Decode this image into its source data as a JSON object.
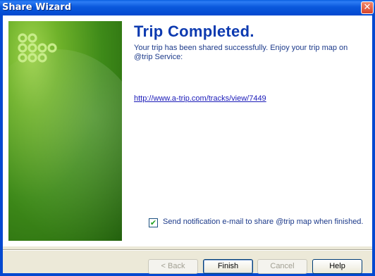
{
  "window": {
    "title": "Share Wizard",
    "close_glyph": "✕"
  },
  "content": {
    "heading": "Trip Completed.",
    "message": "Your trip has been shared successfully. Enjoy your trip map on @trip Service:",
    "link": "http://www.a-trip.com/tracks/view/7449",
    "notify_checked": true,
    "notify_checkmark": "✔",
    "notify_label": "Send notification e-mail to share @trip map when finished."
  },
  "buttons": {
    "back": "< Back",
    "finish": "Finish",
    "cancel": "Cancel",
    "help": "Help"
  },
  "colors": {
    "title_bar": "#0a58dc",
    "heading": "#0d3ab0",
    "side_art_green": "#3e8a19"
  }
}
